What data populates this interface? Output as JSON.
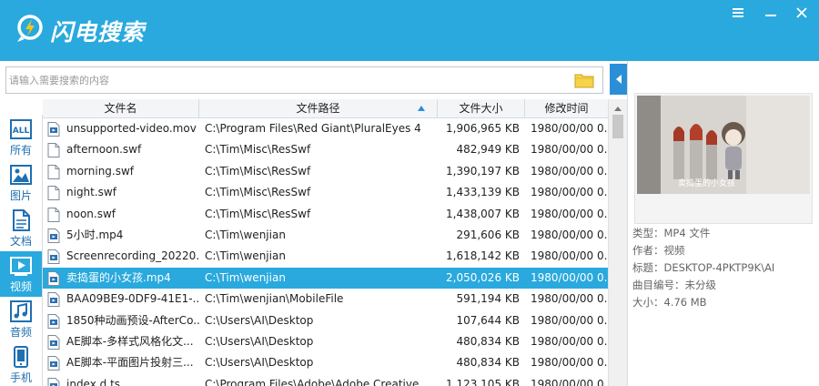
{
  "app": {
    "title": "闪电搜索"
  },
  "search": {
    "placeholder": "请输入需要搜索的内容",
    "value": ""
  },
  "categories": [
    {
      "label": "所有",
      "icon": "all-icon"
    },
    {
      "label": "图片",
      "icon": "image-icon"
    },
    {
      "label": "文档",
      "icon": "document-icon"
    },
    {
      "label": "视频",
      "icon": "video-icon",
      "active": true
    },
    {
      "label": "音频",
      "icon": "audio-icon"
    },
    {
      "label": "手机",
      "icon": "phone-icon"
    }
  ],
  "table": {
    "columns": {
      "name": "文件名",
      "path": "文件路径",
      "size": "文件大小",
      "time": "修改时间"
    },
    "rows": [
      {
        "name": "unsupported-video.mov",
        "path": "C:\\Program Files\\Red Giant\\PluralEyes 4",
        "size": "1,906,965 KB",
        "time": "1980/00/00 0...",
        "icon": "video-file-icon"
      },
      {
        "name": "afternoon.swf",
        "path": "C:\\Tim\\Misc\\ResSwf",
        "size": "482,949 KB",
        "time": "1980/00/00 0...",
        "icon": "file-icon"
      },
      {
        "name": "morning.swf",
        "path": "C:\\Tim\\Misc\\ResSwf",
        "size": "1,390,197 KB",
        "time": "1980/00/00 0...",
        "icon": "file-icon"
      },
      {
        "name": "night.swf",
        "path": "C:\\Tim\\Misc\\ResSwf",
        "size": "1,433,139 KB",
        "time": "1980/00/00 0...",
        "icon": "file-icon"
      },
      {
        "name": "noon.swf",
        "path": "C:\\Tim\\Misc\\ResSwf",
        "size": "1,438,007 KB",
        "time": "1980/00/00 0...",
        "icon": "file-icon"
      },
      {
        "name": "5小时.mp4",
        "path": "C:\\Tim\\wenjian",
        "size": "291,606 KB",
        "time": "1980/00/00 0...",
        "icon": "video-file-icon"
      },
      {
        "name": "Screenrecording_20220...",
        "path": "C:\\Tim\\wenjian",
        "size": "1,618,142 KB",
        "time": "1980/00/00 0...",
        "icon": "video-file-icon"
      },
      {
        "name": "卖捣蛋的小女孩.mp4",
        "path": "C:\\Tim\\wenjian",
        "size": "2,050,026 KB",
        "time": "1980/00/00 0...",
        "icon": "video-file-icon",
        "selected": true
      },
      {
        "name": "BAA09BE9-0DF9-41E1-...",
        "path": "C:\\Tim\\wenjian\\MobileFile",
        "size": "591,194 KB",
        "time": "1980/00/00 0...",
        "icon": "video-file-icon"
      },
      {
        "name": "1850种动画预设-AfterCo...",
        "path": "C:\\Users\\AI\\Desktop",
        "size": "107,644 KB",
        "time": "1980/00/00 0...",
        "icon": "video-file-icon"
      },
      {
        "name": "AE脚本-多样式风格化文...",
        "path": "C:\\Users\\AI\\Desktop",
        "size": "480,834 KB",
        "time": "1980/00/00 0...",
        "icon": "video-file-icon"
      },
      {
        "name": "AE脚本-平面图片投射三...",
        "path": "C:\\Users\\AI\\Desktop",
        "size": "480,834 KB",
        "time": "1980/00/00 0...",
        "icon": "video-file-icon"
      },
      {
        "name": "index.d.ts",
        "path": "C:\\Program Files\\Adobe\\Adobe Creative ...",
        "size": "1,123,105 KB",
        "time": "1980/00/00 0...",
        "icon": "video-file-icon"
      }
    ]
  },
  "preview": {
    "caption": "卖捣蛋的小女孩",
    "meta": [
      "类型：MP4 文件",
      "作者：视频",
      "标题：DESKTOP-4PKTP9K\\AI",
      "曲目编号：未分级",
      "大小：4.76 MB"
    ]
  },
  "colors": {
    "accent": "#29a9de",
    "link": "#1f6fb2",
    "selection": "#29a9de"
  }
}
